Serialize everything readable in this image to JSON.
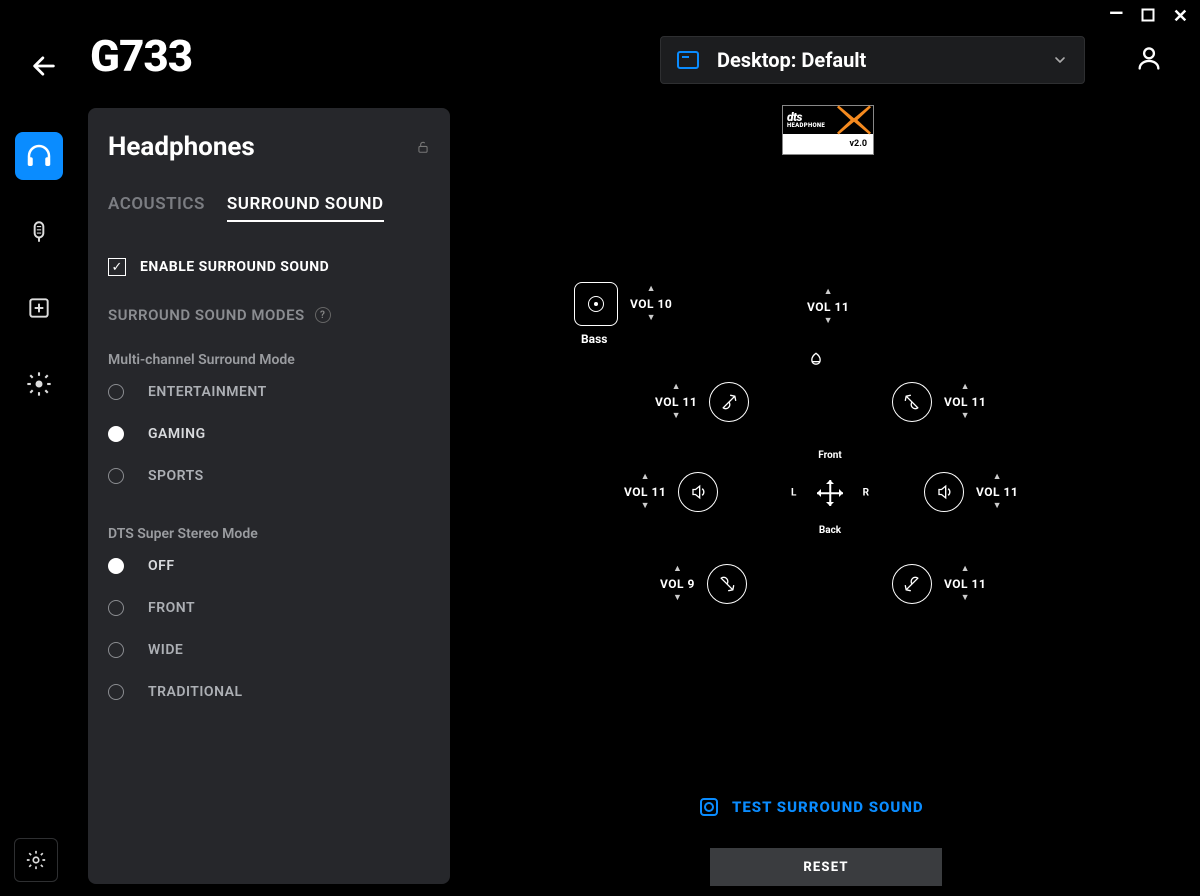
{
  "device_title": "G733",
  "profile": {
    "label": "Desktop: Default"
  },
  "panel": {
    "title": "Headphones",
    "tabs": {
      "acoustics": "ACOUSTICS",
      "surround": "SURROUND SOUND",
      "active": "surround"
    },
    "enable_label": "ENABLE SURROUND SOUND",
    "enable_checked": true,
    "modes_header": "SURROUND SOUND MODES",
    "multi_header": "Multi-channel Surround Mode",
    "multi_options": [
      {
        "id": "entertainment",
        "label": "ENTERTAINMENT",
        "selected": false
      },
      {
        "id": "gaming",
        "label": "GAMING",
        "selected": true
      },
      {
        "id": "sports",
        "label": "SPORTS",
        "selected": false
      }
    ],
    "dts_header": "DTS Super Stereo Mode",
    "dts_options": [
      {
        "id": "off",
        "label": "OFF",
        "selected": true
      },
      {
        "id": "front",
        "label": "FRONT",
        "selected": false
      },
      {
        "id": "wide",
        "label": "WIDE",
        "selected": false
      },
      {
        "id": "traditional",
        "label": "TRADITIONAL",
        "selected": false
      }
    ]
  },
  "dts_badge": {
    "line1": "dts",
    "line2": "HEADPHONE",
    "version": "v2.0"
  },
  "stage": {
    "bass": {
      "label": "Bass",
      "vol": "VOL 10"
    },
    "center": {
      "vol": "VOL 11"
    },
    "front_left": {
      "vol": "VOL 11"
    },
    "front_right": {
      "vol": "VOL 11"
    },
    "side_left": {
      "vol": "VOL 11"
    },
    "side_right": {
      "vol": "VOL 11"
    },
    "rear_left": {
      "vol": "VOL 9"
    },
    "rear_right": {
      "vol": "VOL 11"
    },
    "compass": {
      "front": "Front",
      "back": "Back",
      "left": "L",
      "right": "R"
    }
  },
  "test_label": "TEST SURROUND SOUND",
  "reset_label": "RESET"
}
